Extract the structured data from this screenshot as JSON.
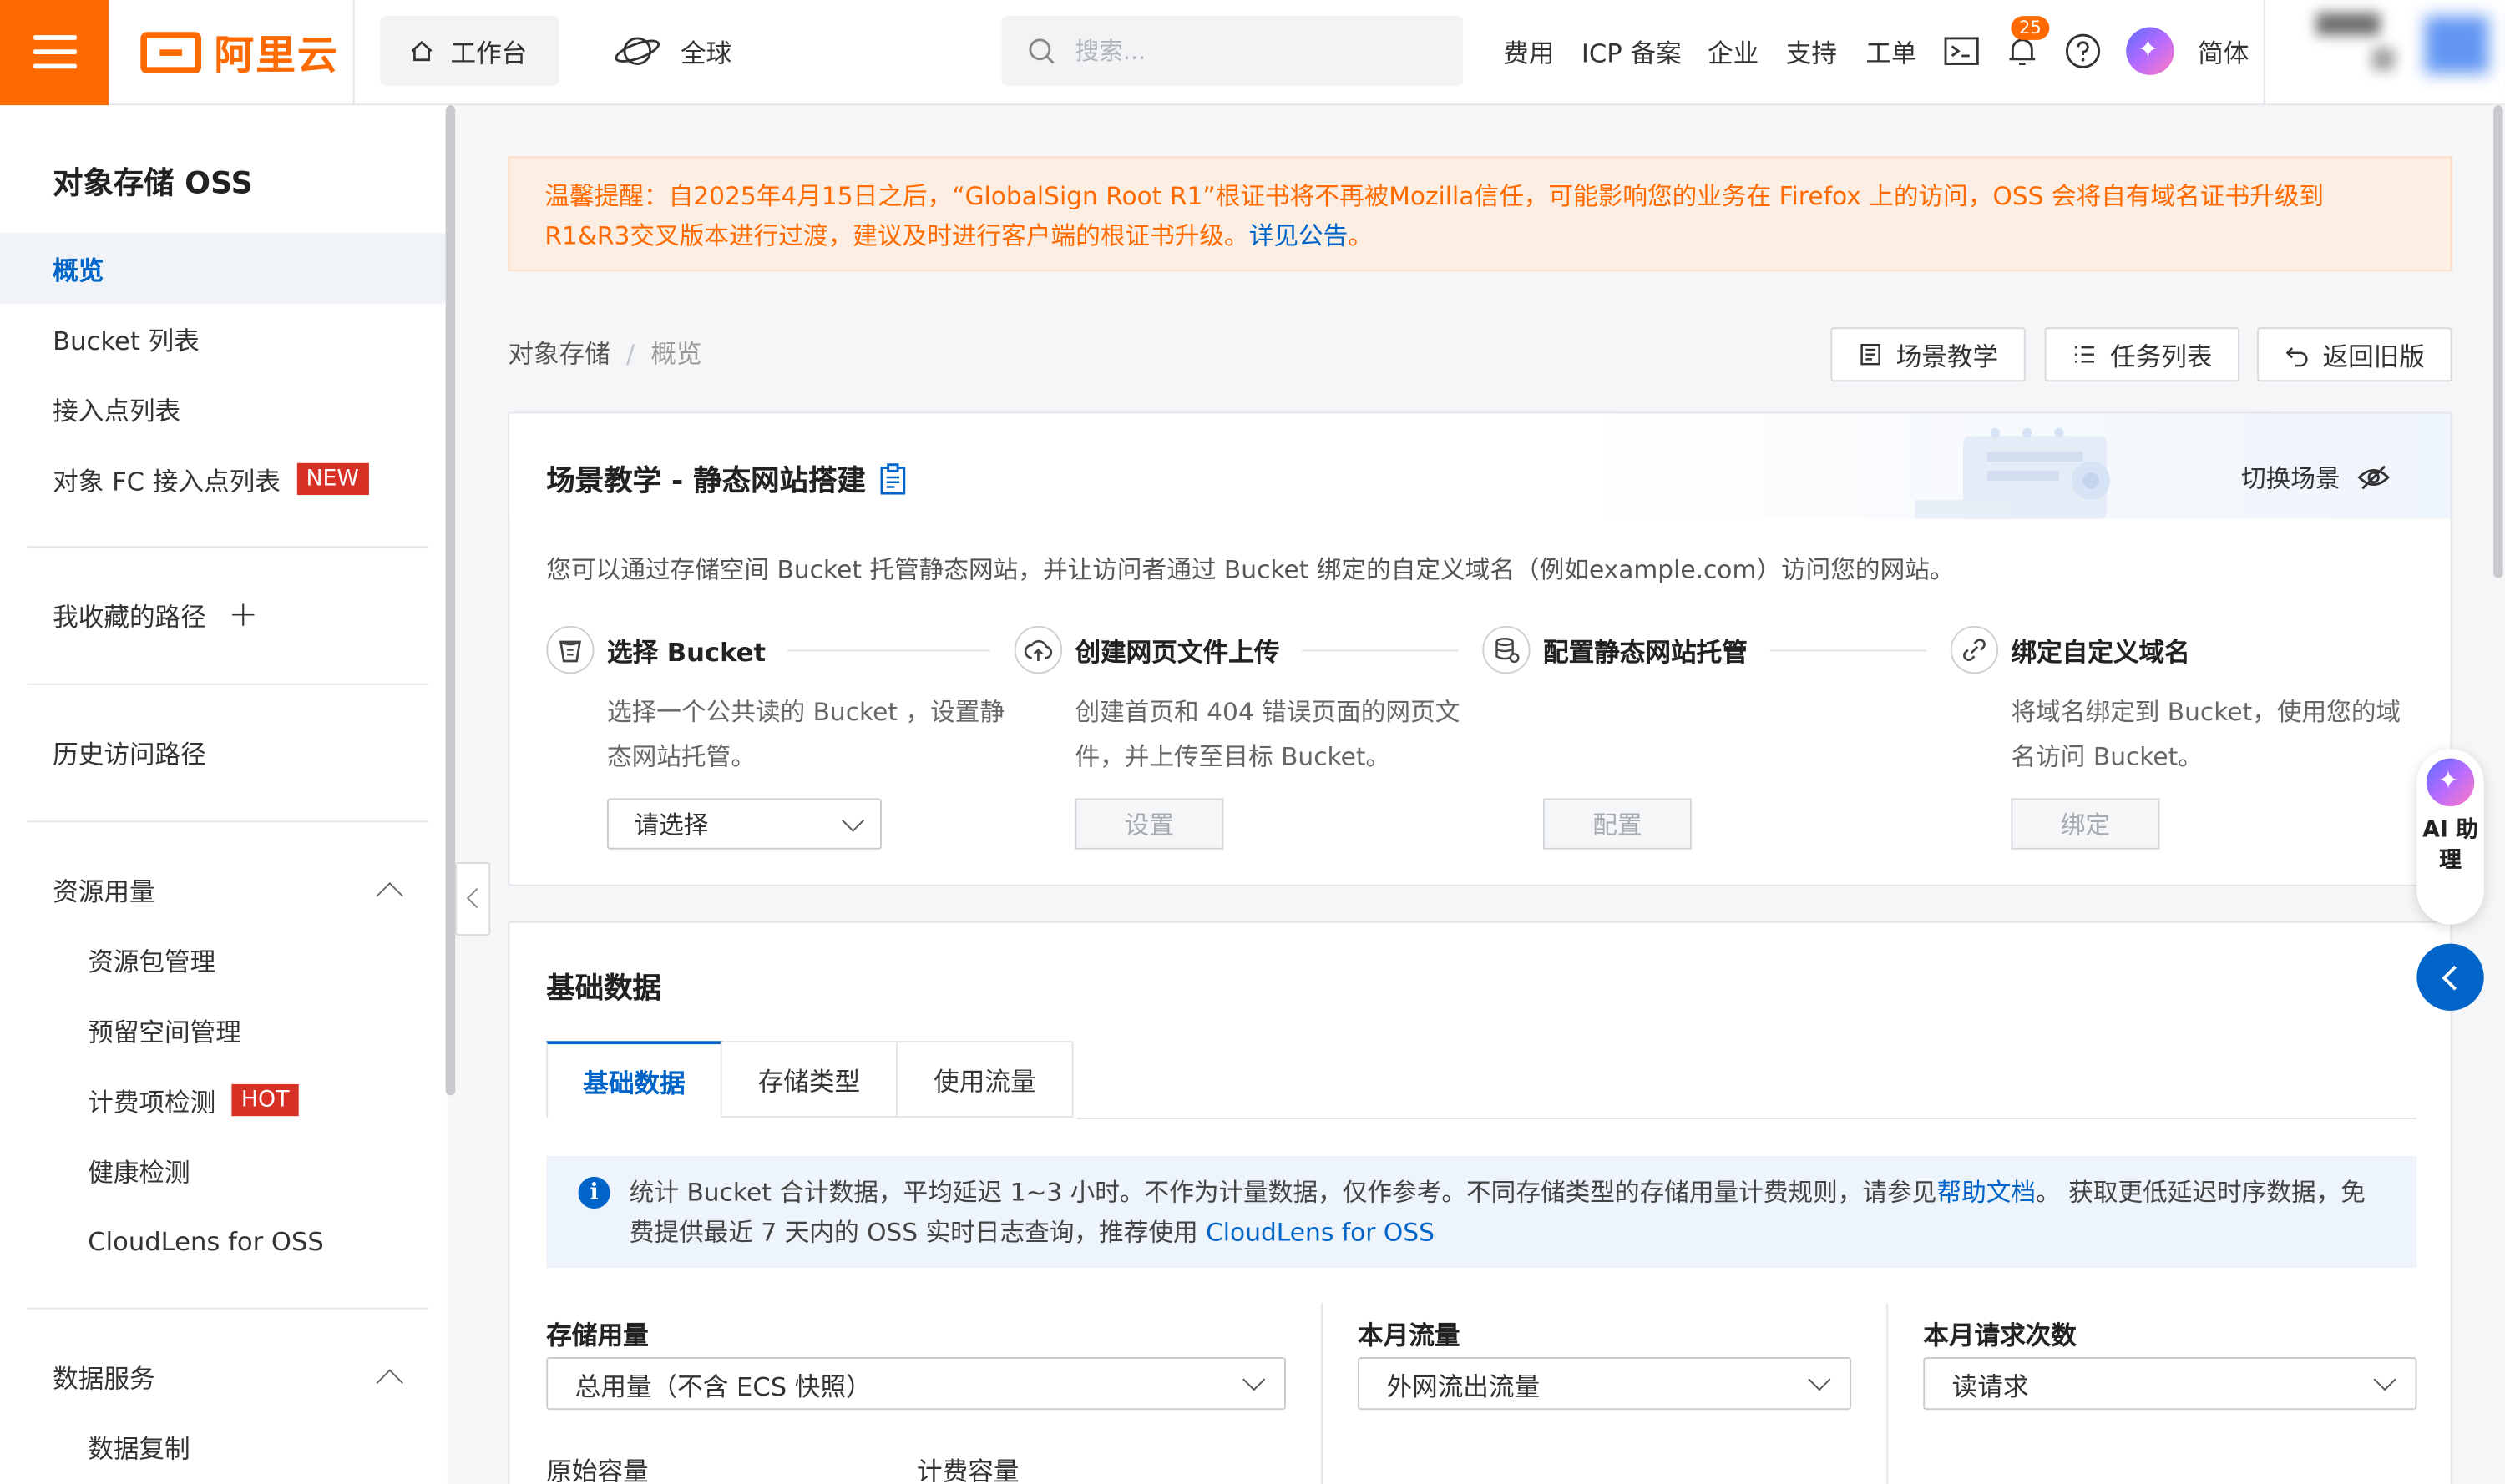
{
  "topbar": {
    "logo_text": "阿里云",
    "workbench": "工作台",
    "region": "全球",
    "search_placeholder": "搜索...",
    "nav": [
      "费用",
      "ICP 备案",
      "企业",
      "支持",
      "工单"
    ],
    "notification_count": "25",
    "language": "简体"
  },
  "sidebar": {
    "title": "对象存储 OSS",
    "items": [
      {
        "label": "概览",
        "active": true
      },
      {
        "label": "Bucket 列表"
      },
      {
        "label": "接入点列表"
      },
      {
        "label": "对象 FC 接入点列表",
        "tag": "NEW"
      }
    ],
    "favorites": "我收藏的路径",
    "history": "历史访问路径",
    "resource_group": "资源用量",
    "resource_items": [
      {
        "label": "资源包管理"
      },
      {
        "label": "预留空间管理"
      },
      {
        "label": "计费项检测",
        "tag": "HOT"
      },
      {
        "label": "健康检测"
      },
      {
        "label": "CloudLens for OSS"
      }
    ],
    "data_group": "数据服务",
    "data_items": [
      {
        "label": "数据复制"
      }
    ]
  },
  "notice": {
    "text": "温馨提醒：自2025年4月15日之后，“GlobalSign Root R1”根证书将不再被Mozilla信任，可能影响您的业务在 Firefox 上的访问，OSS 会将自有域名证书升级到 R1&R3交叉版本进行过渡，建议及时进行客户端的根证书升级。",
    "link": "详见公告",
    "suffix": "。"
  },
  "breadcrumb": {
    "root": "对象存储",
    "sep": "/",
    "current": "概览"
  },
  "actions": {
    "tutorial": "场景教学",
    "tasks": "任务列表",
    "back": "返回旧版"
  },
  "scenario": {
    "title": "场景教学 - 静态网站搭建",
    "switch": "切换场景",
    "desc": "您可以通过存储空间 Bucket 托管静态网站，并让访问者通过 Bucket 绑定的自定义域名（例如example.com）访问您的网站。",
    "steps": [
      {
        "title": "选择 Bucket",
        "desc": "选择一个公共读的 Bucket ，设置静态网站托管。",
        "control": "请选择"
      },
      {
        "title": "创建网页文件上传",
        "desc": "创建首页和 404 错误页面的网页文件，并上传至目标 Bucket。",
        "control": "设置"
      },
      {
        "title": "配置静态网站托管",
        "desc": "",
        "control": "配置"
      },
      {
        "title": "绑定自定义域名",
        "desc": "将域名绑定到 Bucket，使用您的域名访问 Bucket。",
        "control": "绑定"
      }
    ]
  },
  "basic": {
    "title": "基础数据",
    "tabs": [
      "基础数据",
      "存储类型",
      "使用流量"
    ],
    "info_text": "统计 Bucket 合计数据，平均延迟 1~3 小时。不作为计量数据，仅作参考。不同存储类型的存储用量计费规则，请参见",
    "info_link1": "帮助文档",
    "info_text2": "。 获取更低延迟时序数据，免费提供最近 7 天内的 OSS 实时日志查询，推荐使用 ",
    "info_link2": "CloudLens for OSS",
    "col1_label": "存储用量",
    "col1_value": "总用量（不含 ECS 快照）",
    "col2_label": "本月流量",
    "col2_value": "外网流出流量",
    "col3_label": "本月请求次数",
    "col3_value": "读请求",
    "sub1": "原始容量",
    "sub2": "计费容量"
  },
  "ai_assistant": "AI 助理",
  "colors": {
    "brand": "#ff6a00",
    "primary": "#0064c8",
    "tag": "#d93026"
  }
}
